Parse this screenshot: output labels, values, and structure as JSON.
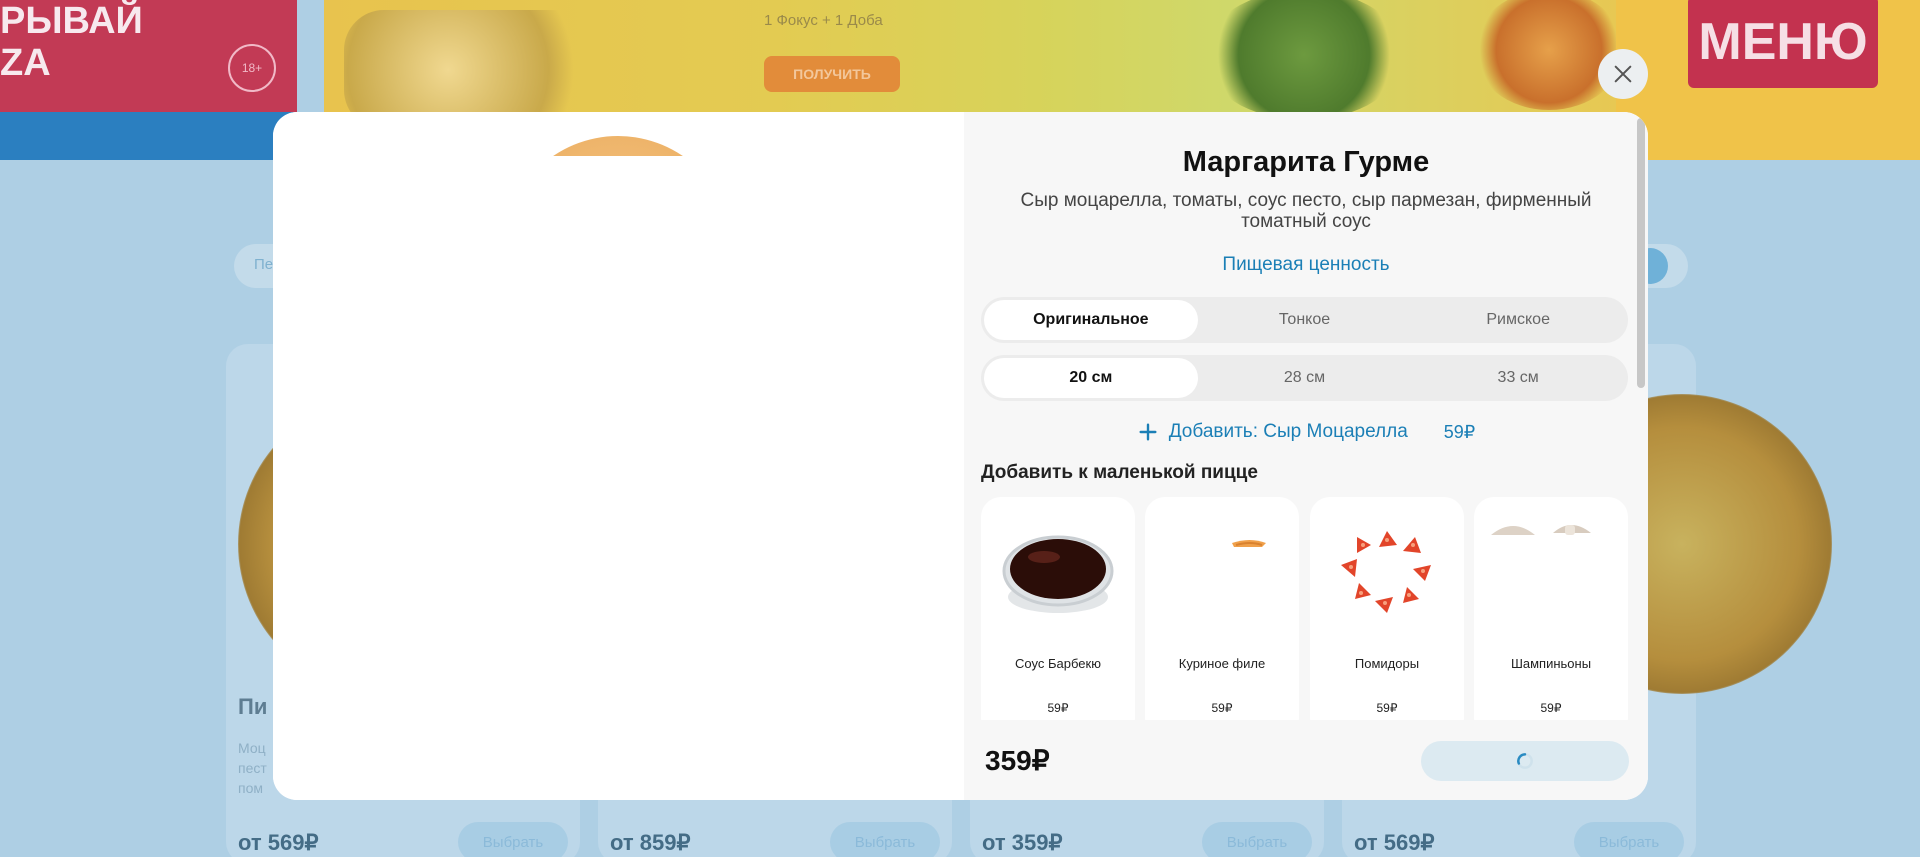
{
  "colors": {
    "accent": "#1b7fb6",
    "overlay": "#aecfe4",
    "modal_bg": "#ffffff",
    "panel_bg": "#f7f7f7",
    "segment_bg": "#ececec",
    "button_loading_bg": "#dceaf1"
  },
  "background": {
    "promo_left_text": "РЫВАЙ\nZA",
    "promo_left_age": "18+",
    "banner_crumb": "1 Фокус + 1 Доба",
    "banner_button": "ПОЛУЧИТЬ",
    "menu_sign": "МЕНЮ",
    "filter_chip": "Пе",
    "cards": [
      {
        "title": "Пи",
        "desc": "Моц\nпест\nпом",
        "price": "от 569₽",
        "button": "Выбрать"
      },
      {
        "title": "",
        "desc": "",
        "price": "от 859₽",
        "button": "Выбрать"
      },
      {
        "title": "",
        "desc": "",
        "price": "от 359₽",
        "button": "Выбрать"
      },
      {
        "title": "",
        "desc": "",
        "price": "от 569₽",
        "button": "Выбрать"
      }
    ]
  },
  "modal": {
    "close_icon": "close-icon",
    "title": "Маргарита Гурме",
    "description": "Сыр моцарелла, томаты, соус песто, сыр пармезан, фирменный томатный соус",
    "nutrition_link": "Пищевая ценность",
    "dough_options": [
      {
        "label": "Оригинальное",
        "active": true
      },
      {
        "label": "Тонкое",
        "active": false
      },
      {
        "label": "Римское",
        "active": false
      }
    ],
    "size_options": [
      {
        "label": "20 см",
        "active": true
      },
      {
        "label": "28 см",
        "active": false
      },
      {
        "label": "33 см",
        "active": false
      }
    ],
    "add_extra": {
      "label": "Добавить: Сыр Моцарелла",
      "price": "59₽",
      "icon": "plus-icon"
    },
    "toppings_title": "Добавить к маленькой пицце",
    "toppings": [
      {
        "name": "Соус Барбекю",
        "price": "59₽",
        "icon": "bbq-sauce-image"
      },
      {
        "name": "Куриное филе",
        "price": "59₽",
        "icon": "chicken-fillet-image"
      },
      {
        "name": "Помидоры",
        "price": "59₽",
        "icon": "tomatoes-image"
      },
      {
        "name": "Шампиньоны",
        "price": "59₽",
        "icon": "mushrooms-image"
      }
    ],
    "total_price": "359₽",
    "add_button_state": "loading",
    "add_button_icon": "spinner-icon"
  }
}
